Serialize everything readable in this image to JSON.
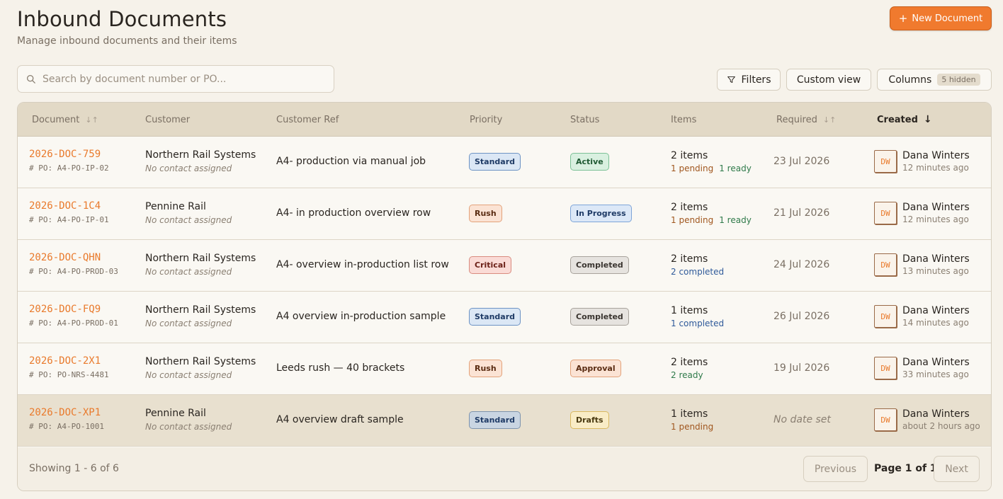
{
  "header": {
    "title": "Inbound Documents",
    "subtitle": "Manage inbound documents and their items",
    "new_button": "New Document"
  },
  "search": {
    "placeholder": "Search by document number or PO...",
    "value": ""
  },
  "toolbar": {
    "filters": "Filters",
    "custom_view": "Custom view",
    "columns": "Columns",
    "hidden_count": "5 hidden"
  },
  "columns": [
    "Document",
    "Customer",
    "Customer Ref",
    "Priority",
    "Status",
    "Items",
    "Required",
    "Created"
  ],
  "rows": [
    {
      "doc": "2026-DOC-759",
      "po": "PO: A4-PO-IP-02",
      "customer": "Northern Rail Systems",
      "contact": "No contact assigned",
      "ref": "A4- production via manual job",
      "priority": "Standard",
      "status": "Active",
      "items": "2 items",
      "items_a": "1 pending",
      "items_b": "1 ready",
      "required": "23 Jul 2026",
      "initials": "DW",
      "creator": "Dana Winters",
      "created": "12 minutes ago"
    },
    {
      "doc": "2026-DOC-1C4",
      "po": "PO: A4-PO-IP-01",
      "customer": "Pennine Rail",
      "contact": "No contact assigned",
      "ref": "A4- in production overview row",
      "priority": "Rush",
      "status": "In Progress",
      "items": "2 items",
      "items_a": "1 pending",
      "items_b": "1 ready",
      "required": "21 Jul 2026",
      "initials": "DW",
      "creator": "Dana Winters",
      "created": "12 minutes ago"
    },
    {
      "doc": "2026-DOC-QHN",
      "po": "PO: A4-PO-PROD-03",
      "customer": "Northern Rail Systems",
      "contact": "No contact assigned",
      "ref": "A4- overview in-production list row",
      "priority": "Critical",
      "status": "Completed",
      "items": "2 items",
      "items_a": "2 completed",
      "items_b": "",
      "required": "24 Jul 2026",
      "initials": "DW",
      "creator": "Dana Winters",
      "created": "13 minutes ago"
    },
    {
      "doc": "2026-DOC-FQ9",
      "po": "PO: A4-PO-PROD-01",
      "customer": "Northern Rail Systems",
      "contact": "No contact assigned",
      "ref": "A4 overview in-production sample",
      "priority": "Standard",
      "status": "Completed",
      "items": "1 items",
      "items_a": "1 completed",
      "items_b": "",
      "required": "26 Jul 2026",
      "initials": "DW",
      "creator": "Dana Winters",
      "created": "14 minutes ago"
    },
    {
      "doc": "2026-DOC-2X1",
      "po": "PO: PO-NRS-4481",
      "customer": "Northern Rail Systems",
      "contact": "No contact assigned",
      "ref": "Leeds rush — 40 brackets",
      "priority": "Rush",
      "status": "Approval",
      "items": "2 items",
      "items_a": "2 ready",
      "items_b": "",
      "required": "19 Jul 2026",
      "initials": "DW",
      "creator": "Dana Winters",
      "created": "33 minutes ago"
    },
    {
      "doc": "2026-DOC-XP1",
      "po": "PO: A4-PO-1001",
      "customer": "Pennine Rail",
      "contact": "No contact assigned",
      "ref": "A4 overview draft sample",
      "priority": "Standard",
      "status": "Drafts",
      "items": "1 items",
      "items_a": "1 pending",
      "items_b": "",
      "required": "No date set",
      "initials": "DW",
      "creator": "Dana Winters",
      "created": "about 2 hours ago"
    }
  ],
  "footer": {
    "showing": "Showing 1 - 6 of 6",
    "previous": "Previous",
    "page_info": "Page 1 of 1",
    "next": "Next"
  },
  "colors": {
    "accent": "#f07a2e",
    "pending": "#a0561e",
    "ready": "#2f7a4a",
    "completed": "#2f5a9a"
  }
}
